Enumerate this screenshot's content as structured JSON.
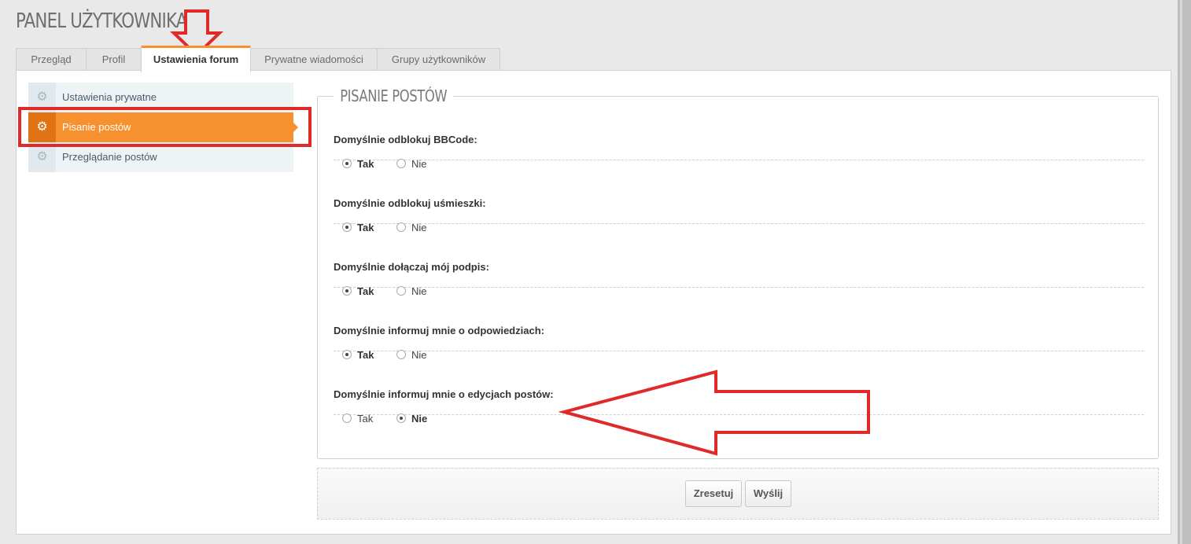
{
  "page_title": "PANEL UŻYTKOWNIKA",
  "tabs": [
    {
      "label": "Przegląd"
    },
    {
      "label": "Profil"
    },
    {
      "label": "Ustawienia forum",
      "active": true
    },
    {
      "label": "Prywatne wiadomości"
    },
    {
      "label": "Grupy użytkowników"
    }
  ],
  "sidebar": {
    "items": [
      {
        "label": "Ustawienia prywatne",
        "icon": "gear-icon"
      },
      {
        "label": "Pisanie postów",
        "icon": "gear-icon",
        "active": true
      },
      {
        "label": "Przeglądanie postów",
        "icon": "gear-icon"
      }
    ]
  },
  "section": {
    "title": "PISANIE POSTÓW",
    "options": [
      {
        "label": "Domyślnie odblokuj BBCode:",
        "yes": "Tak",
        "no": "Nie",
        "selected": "Tak"
      },
      {
        "label": "Domyślnie odblokuj uśmieszki:",
        "yes": "Tak",
        "no": "Nie",
        "selected": "Tak"
      },
      {
        "label": "Domyślnie dołączaj mój podpis:",
        "yes": "Tak",
        "no": "Nie",
        "selected": "Tak"
      },
      {
        "label": "Domyślnie informuj mnie o odpowiedziach:",
        "yes": "Tak",
        "no": "Nie",
        "selected": "Tak"
      },
      {
        "label": "Domyślnie informuj mnie o edycjach postów:",
        "yes": "Tak",
        "no": "Nie",
        "selected": "Nie"
      }
    ]
  },
  "buttons": {
    "reset": "Zresetuj",
    "submit": "Wyślij"
  },
  "colors": {
    "accent": "#f7902f",
    "accent_dark": "#e07414",
    "annotation": "#e02a2a"
  }
}
